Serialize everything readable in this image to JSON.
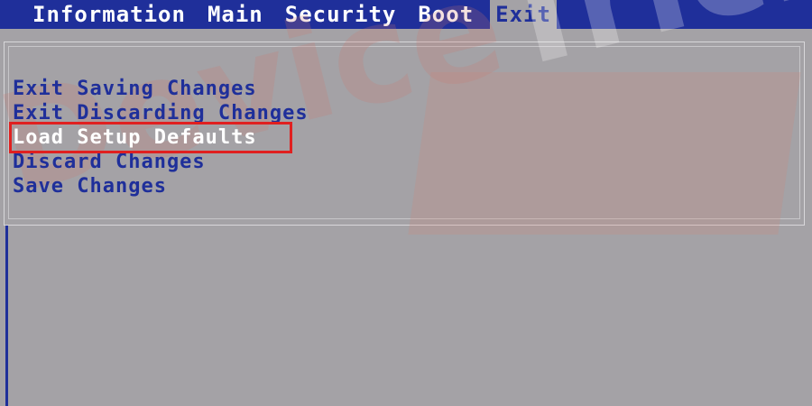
{
  "tabs": [
    {
      "label": "Information",
      "active": false
    },
    {
      "label": "Main",
      "active": false
    },
    {
      "label": "Security",
      "active": false
    },
    {
      "label": "Boot",
      "active": false
    },
    {
      "label": "Exit",
      "active": true
    }
  ],
  "menu": {
    "items": [
      {
        "label": "Exit Saving Changes"
      },
      {
        "label": "Exit Discarding Changes"
      },
      {
        "label": "Load Setup Defaults",
        "selected": true
      },
      {
        "label": "Discard Changes"
      },
      {
        "label": "Save Changes"
      }
    ]
  },
  "watermark": {
    "part1": "Device",
    "part2": "Tricks"
  },
  "colors": {
    "menubar": "#1f2f9a",
    "background": "#a4a2a6",
    "item_text": "#1f2f9a",
    "selected_text": "#ffffff",
    "highlight_outline": "#e02020"
  }
}
